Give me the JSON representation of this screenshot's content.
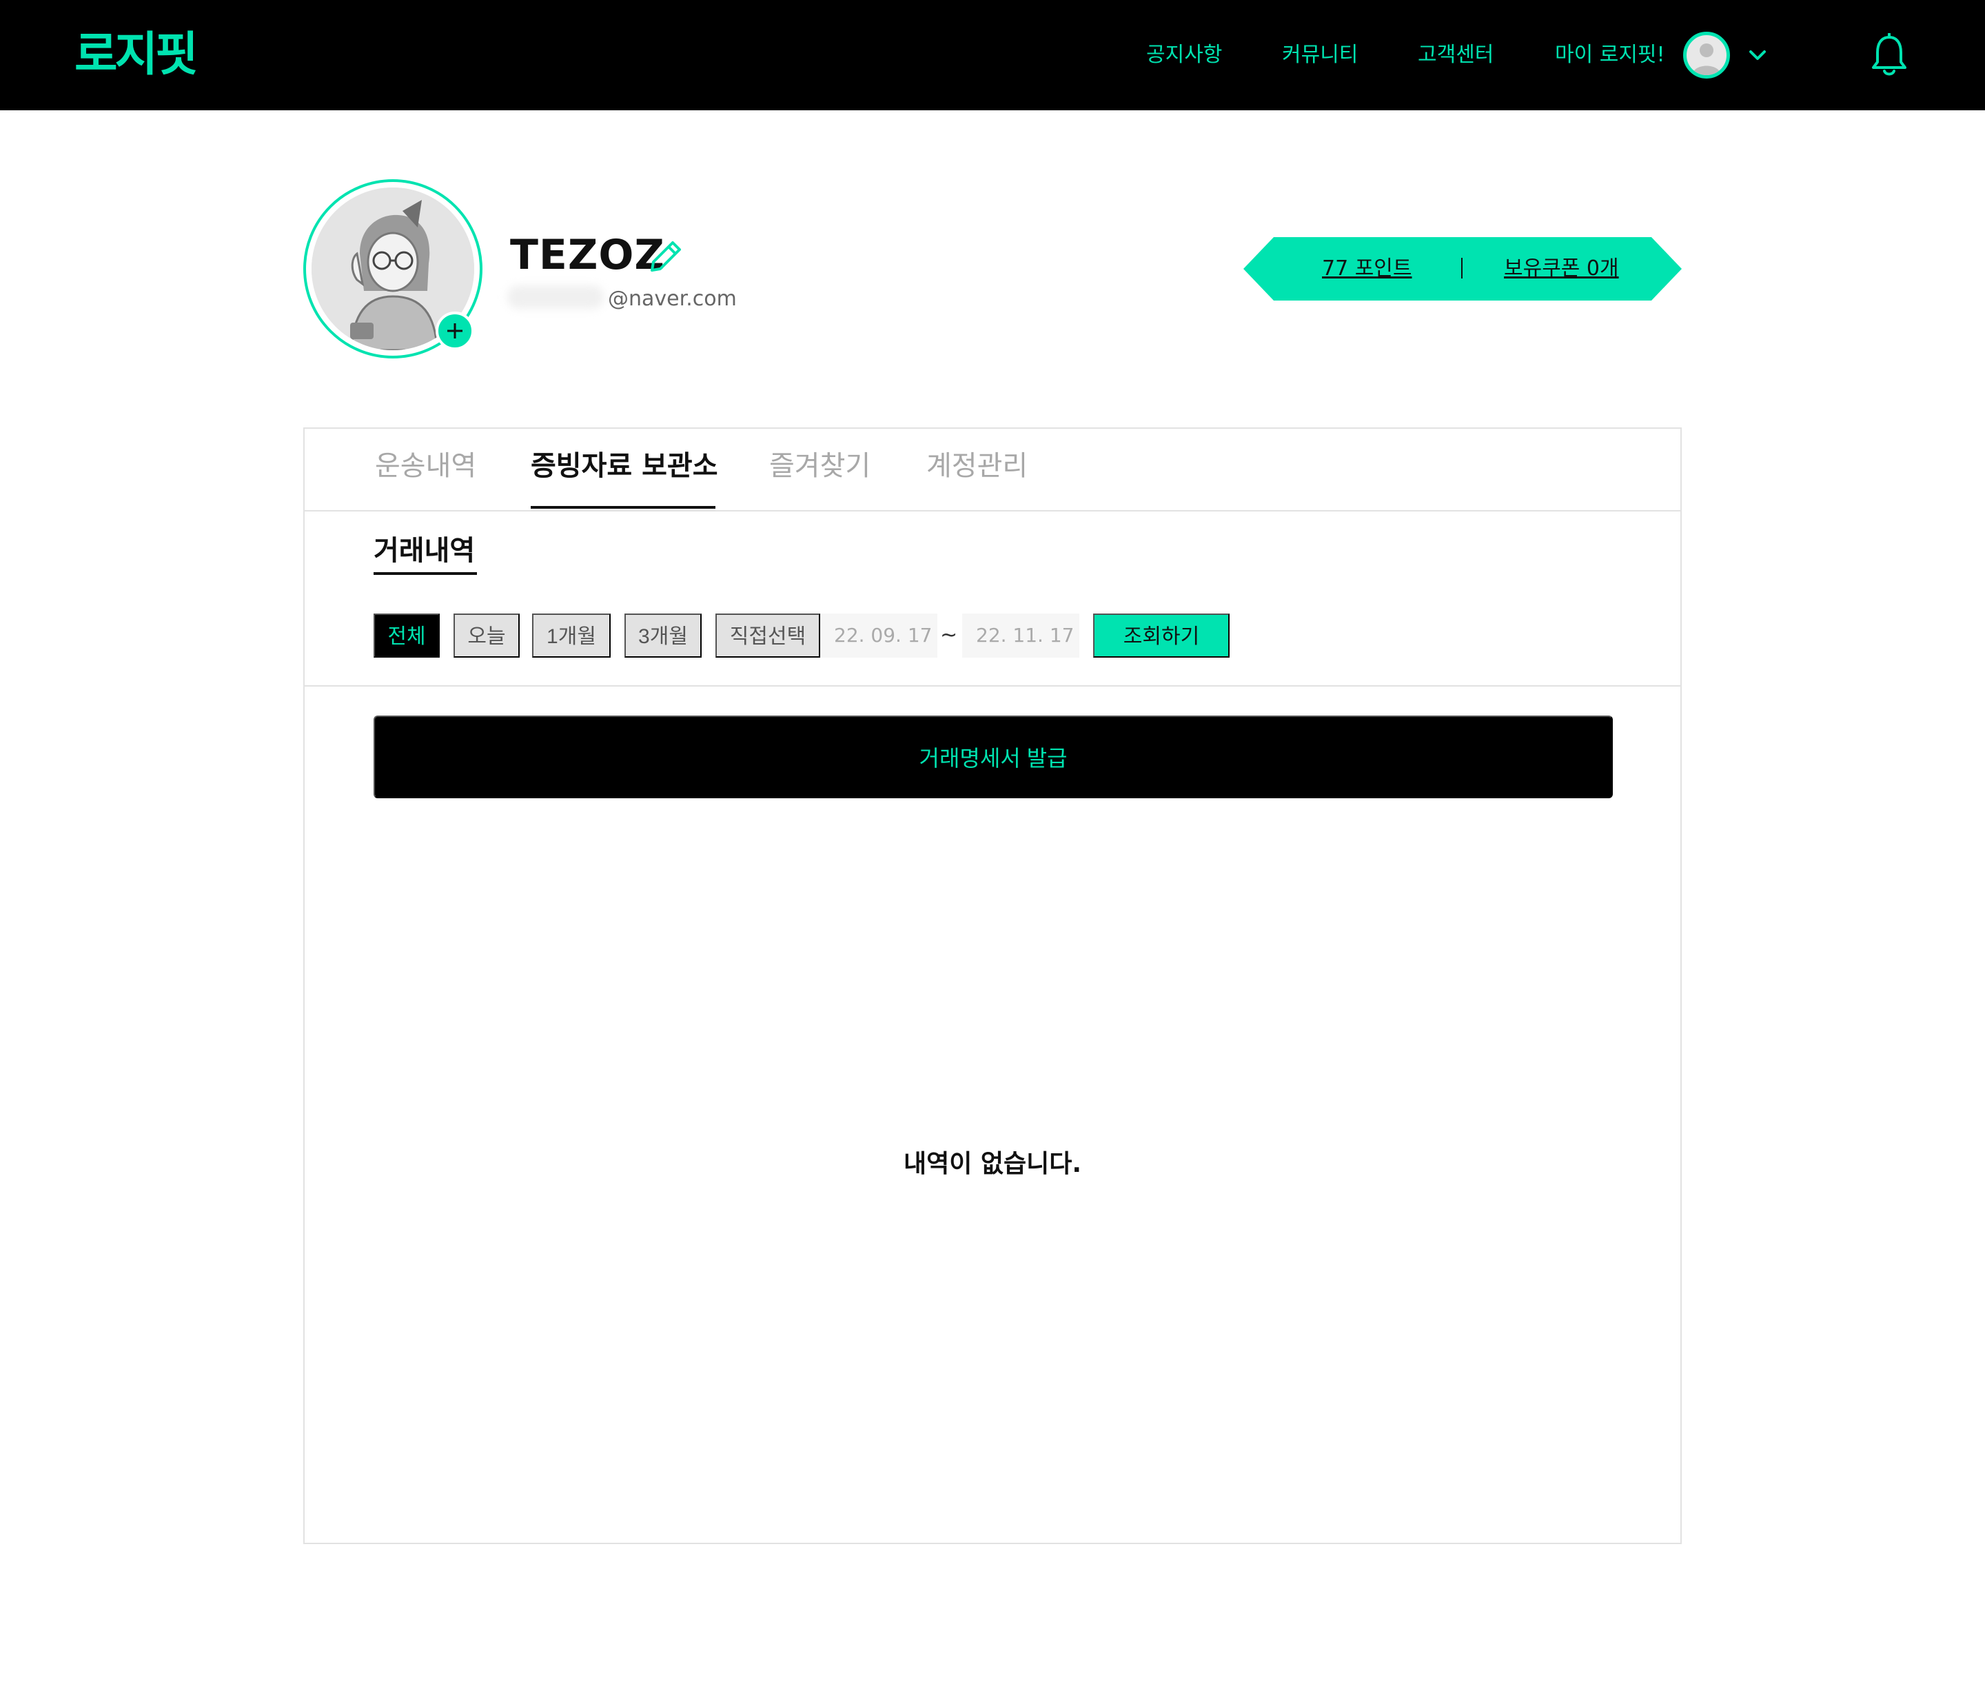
{
  "header": {
    "logo": "로지핏",
    "nav": [
      "공지사항",
      "커뮤니티",
      "고객센터",
      "마이 로지핏!"
    ],
    "accent_color": "#00e3b0"
  },
  "profile": {
    "username": "TEZOZ",
    "email_domain": "@naver.com",
    "points_label": "77 포인트",
    "coupon_label": "보유쿠폰 0개"
  },
  "tabs": [
    "운송내역",
    "증빙자료 보관소",
    "즐겨찾기",
    "계정관리"
  ],
  "active_tab": "증빙자료 보관소",
  "section": {
    "title": "거래내역",
    "filters": [
      "전체",
      "오늘",
      "1개월",
      "3개월",
      "직접선택"
    ],
    "active_filter": "전체",
    "date_from": "22. 09. 17",
    "date_separator": "~",
    "date_to": "22. 11. 17",
    "search_label": "조회하기",
    "issue_label": "거래명세서 발급",
    "empty_message": "내역이 없습니다."
  },
  "icons": [
    "avatar",
    "chevron-down-icon",
    "bell-icon",
    "plus-icon",
    "pencil-icon"
  ]
}
